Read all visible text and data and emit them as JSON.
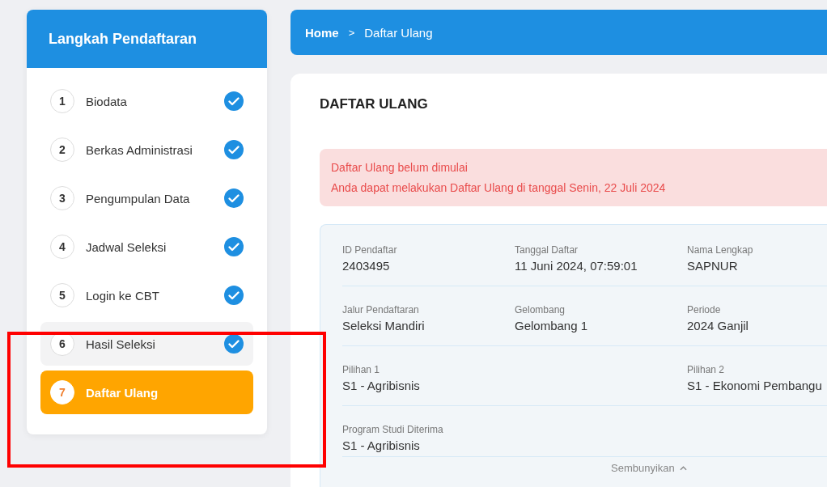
{
  "sidebar": {
    "title": "Langkah Pendaftaran",
    "steps": [
      {
        "number": "1",
        "label": "Biodata",
        "done": true,
        "selected": false,
        "hovered": false
      },
      {
        "number": "2",
        "label": "Berkas Administrasi",
        "done": true,
        "selected": false,
        "hovered": false
      },
      {
        "number": "3",
        "label": "Pengumpulan Data",
        "done": true,
        "selected": false,
        "hovered": false
      },
      {
        "number": "4",
        "label": "Jadwal Seleksi",
        "done": true,
        "selected": false,
        "hovered": false
      },
      {
        "number": "5",
        "label": "Login ke CBT",
        "done": true,
        "selected": false,
        "hovered": false
      },
      {
        "number": "6",
        "label": "Hasil Seleksi",
        "done": true,
        "selected": false,
        "hovered": true
      },
      {
        "number": "7",
        "label": "Daftar Ulang",
        "done": false,
        "selected": true,
        "hovered": false
      }
    ]
  },
  "breadcrumb": [
    {
      "label": "Home",
      "current": false
    },
    {
      "label": "Daftar Ulang",
      "current": true
    }
  ],
  "breadcrumb_separator": ">",
  "page": {
    "title": "DAFTAR ULANG",
    "alert": {
      "kind": "danger",
      "lines": [
        "Daftar Ulang belum dimulai",
        "Anda dapat melakukan Daftar Ulang di tanggal Senin, 22 Juli 2024"
      ]
    },
    "details": [
      {
        "column_1": {
          "label": "ID Pendaftar",
          "value": "2403495"
        },
        "column_2": {
          "label": "Tanggal Daftar",
          "value": "11 Juni 2024, 07:59:01"
        },
        "column_3": {
          "label": "Nama Lengkap",
          "value": "SAPNUR"
        }
      },
      {
        "column_1": {
          "label": "Jalur Pendaftaran",
          "value": "Seleksi Mandiri"
        },
        "column_2": {
          "label": "Gelombang",
          "value": "Gelombang 1"
        },
        "column_3": {
          "label": "Periode",
          "value": "2024 Ganjil"
        }
      },
      {
        "column_1": {
          "label": "Pilihan 1",
          "value": "S1 - Agribisnis"
        },
        "column_3": {
          "label": "Pilihan 2",
          "value": "S1 - Ekonomi Pembangu"
        }
      },
      {
        "column_1": {
          "label": "Program Studi Diterima",
          "value": "S1 - Agribisnis"
        }
      }
    ],
    "toggle": {
      "label": "Sembunyikan",
      "expanded": true
    }
  },
  "annotation": {
    "kind": "highlight_frame"
  }
}
